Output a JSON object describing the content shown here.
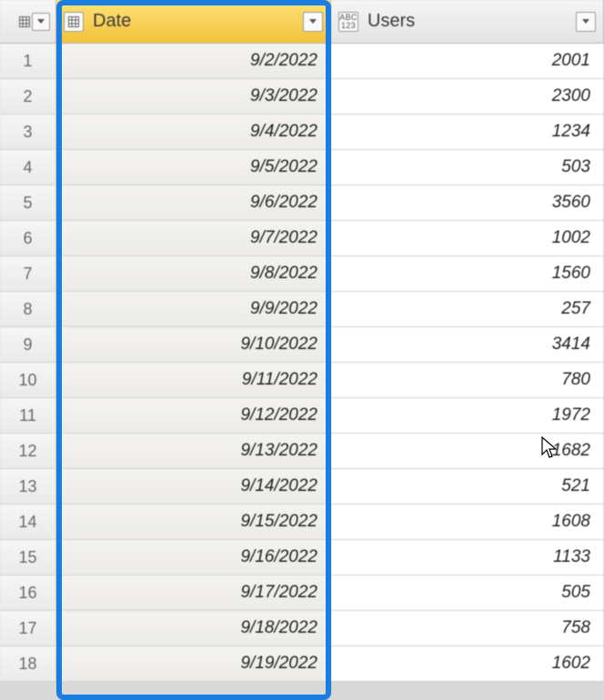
{
  "columns": {
    "date": {
      "label": "Date"
    },
    "users": {
      "label": "Users"
    }
  },
  "rows": [
    {
      "n": 1,
      "date": "9/2/2022",
      "users": 2001
    },
    {
      "n": 2,
      "date": "9/3/2022",
      "users": 2300
    },
    {
      "n": 3,
      "date": "9/4/2022",
      "users": 1234
    },
    {
      "n": 4,
      "date": "9/5/2022",
      "users": 503
    },
    {
      "n": 5,
      "date": "9/6/2022",
      "users": 3560
    },
    {
      "n": 6,
      "date": "9/7/2022",
      "users": 1002
    },
    {
      "n": 7,
      "date": "9/8/2022",
      "users": 1560
    },
    {
      "n": 8,
      "date": "9/9/2022",
      "users": 257
    },
    {
      "n": 9,
      "date": "9/10/2022",
      "users": 3414
    },
    {
      "n": 10,
      "date": "9/11/2022",
      "users": 780
    },
    {
      "n": 11,
      "date": "9/12/2022",
      "users": 1972
    },
    {
      "n": 12,
      "date": "9/13/2022",
      "users": 1682
    },
    {
      "n": 13,
      "date": "9/14/2022",
      "users": 521
    },
    {
      "n": 14,
      "date": "9/15/2022",
      "users": 1608
    },
    {
      "n": 15,
      "date": "9/16/2022",
      "users": 1133
    },
    {
      "n": 16,
      "date": "9/17/2022",
      "users": 505
    },
    {
      "n": 17,
      "date": "9/18/2022",
      "users": 758
    },
    {
      "n": 18,
      "date": "9/19/2022",
      "users": 1602
    }
  ]
}
